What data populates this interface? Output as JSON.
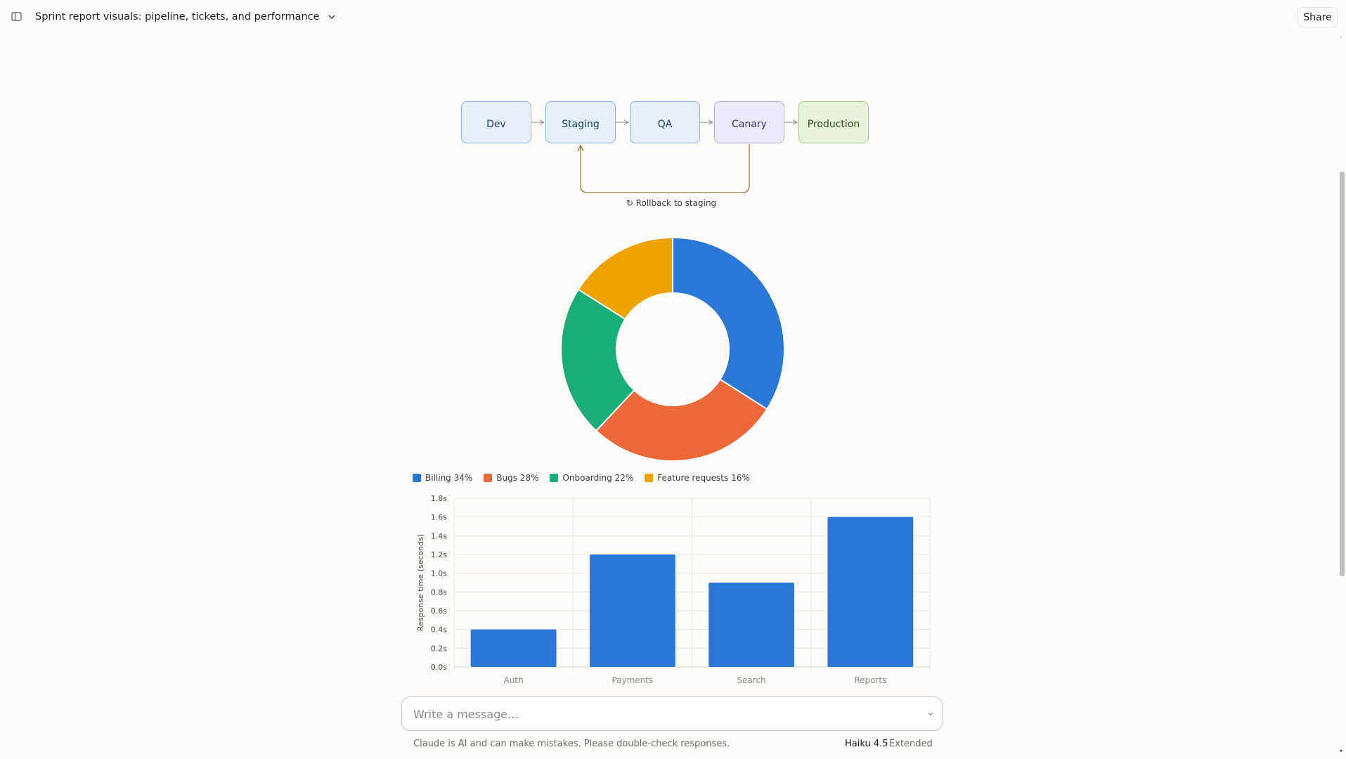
{
  "header": {
    "title": "Sprint report visuals: pipeline, tickets, and performance",
    "share_label": "Share"
  },
  "pipeline": {
    "stages": [
      "Dev",
      "Staging",
      "QA",
      "Canary",
      "Production"
    ],
    "rollback_label": "↻ Rollback to staging",
    "colors": {
      "arrow": "#8a8882",
      "rollback": "#9a7a48"
    }
  },
  "tickets_chart": {
    "chart_data": {
      "type": "pie",
      "variant": "donut",
      "slices": [
        {
          "name": "Billing",
          "value": 34,
          "label": "Billing 34%",
          "color": "#2a78d6"
        },
        {
          "name": "Bugs",
          "value": 28,
          "label": "Bugs 28%",
          "color": "#ec6838"
        },
        {
          "name": "Onboarding",
          "value": 22,
          "label": "Onboarding 22%",
          "color": "#19ad78"
        },
        {
          "name": "Feature requests",
          "value": 16,
          "label": "Feature requests 16%",
          "color": "#eea300"
        }
      ],
      "legend": "bottom-left"
    }
  },
  "performance_chart": {
    "chart_data": {
      "type": "bar",
      "categories": [
        "Auth",
        "Payments",
        "Search",
        "Reports"
      ],
      "values": [
        0.4,
        1.2,
        0.9,
        1.6
      ],
      "ylabel": "Response time (seconds)",
      "ylim": [
        0,
        1.8
      ],
      "yticks": [
        "0.0s",
        "0.2s",
        "0.4s",
        "0.6s",
        "0.8s",
        "1.0s",
        "1.2s",
        "1.4s",
        "1.6s",
        "1.8s"
      ],
      "grid": true,
      "bar_color": "#2a78d6"
    }
  },
  "composer": {
    "placeholder": "Write a message…",
    "disclaimer": "Claude is AI and can make mistakes. Please double-check responses.",
    "model": "Haiku 4.5",
    "mode": "Extended"
  }
}
